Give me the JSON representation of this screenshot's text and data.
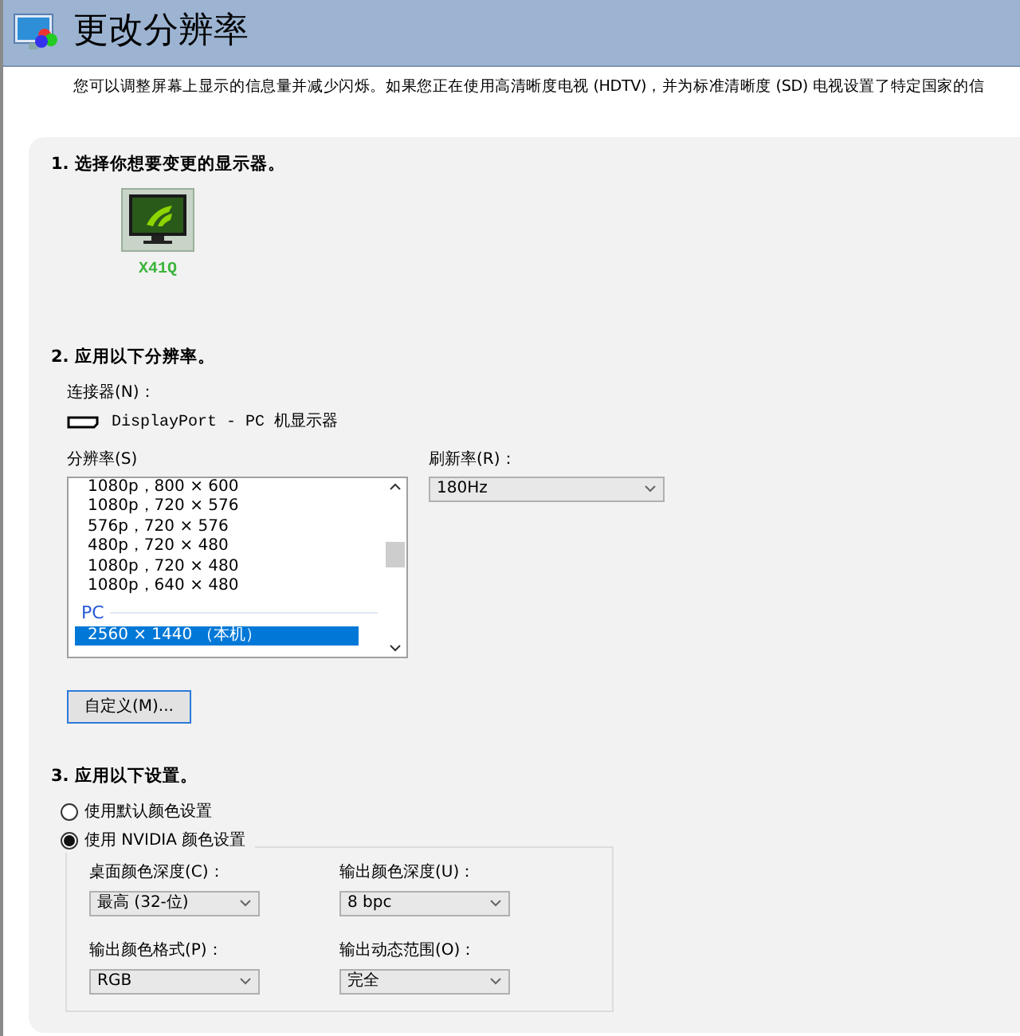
{
  "header": {
    "title": "更改分辨率"
  },
  "description": "您可以调整屏幕上显示的信息量并减少闪烁。如果您正在使用高清晰度电视 (HDTV)，并为标准清晰度 (SD) 电视设置了特定国家的信",
  "step1": {
    "title": "1. 选择你想要变更的显示器。",
    "displays": [
      {
        "label": "X41Q",
        "selected": true
      }
    ]
  },
  "step2": {
    "title": "2. 应用以下分辨率。",
    "connector_label": "连接器(N)：",
    "connector": "DisplayPort - PC 机显示器",
    "resolution_label": "分辨率(S)",
    "resolutions": [
      {
        "kind": "item",
        "text": "1080p，800 × 600",
        "selected": false
      },
      {
        "kind": "item",
        "text": "1080p，720 × 576",
        "selected": false
      },
      {
        "kind": "item",
        "text": "576p，720 × 576",
        "selected": false
      },
      {
        "kind": "item",
        "text": "480p，720 × 480",
        "selected": false
      },
      {
        "kind": "item",
        "text": "1080p，720 × 480",
        "selected": false
      },
      {
        "kind": "item",
        "text": "1080p，640 × 480",
        "selected": false
      },
      {
        "kind": "group",
        "text": "PC"
      },
      {
        "kind": "item",
        "text": "2560 × 1440 （本机）",
        "selected": true
      }
    ],
    "refresh_label": "刷新率(R)：",
    "refresh_value": "180Hz",
    "custom_button": "自定义(M)..."
  },
  "step3": {
    "title": "3. 应用以下设置。",
    "options": [
      {
        "label": "使用默认颜色设置",
        "checked": false
      },
      {
        "label": "使用 NVIDIA 颜色设置",
        "checked": true
      }
    ],
    "settings": [
      {
        "label": "桌面颜色深度(C)：",
        "value": "最高 (32-位)"
      },
      {
        "label": "输出颜色深度(U)：",
        "value": "8 bpc"
      },
      {
        "label": "输出颜色格式(P)：",
        "value": "RGB"
      },
      {
        "label": "输出动态范围(O)：",
        "value": "完全"
      }
    ]
  }
}
